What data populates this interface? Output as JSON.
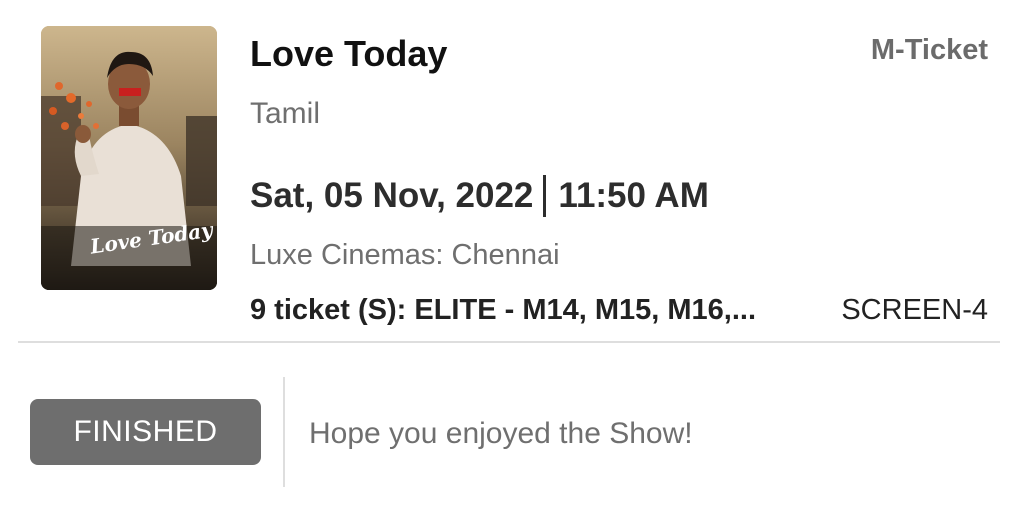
{
  "booking": {
    "movie_title": "Love Today",
    "ticket_type": "M-Ticket",
    "language": "Tamil",
    "date": "Sat, 05 Nov, 2022",
    "time": "11:50 AM",
    "venue": "Luxe Cinemas: Chennai",
    "seats": "9 ticket (S): ELITE - M14, M15, M16,...",
    "screen": "SCREEN-4",
    "poster": {
      "logo_text": "Love Today"
    }
  },
  "status": {
    "label": "FINISHED",
    "message": "Hope you enjoyed the Show!"
  }
}
